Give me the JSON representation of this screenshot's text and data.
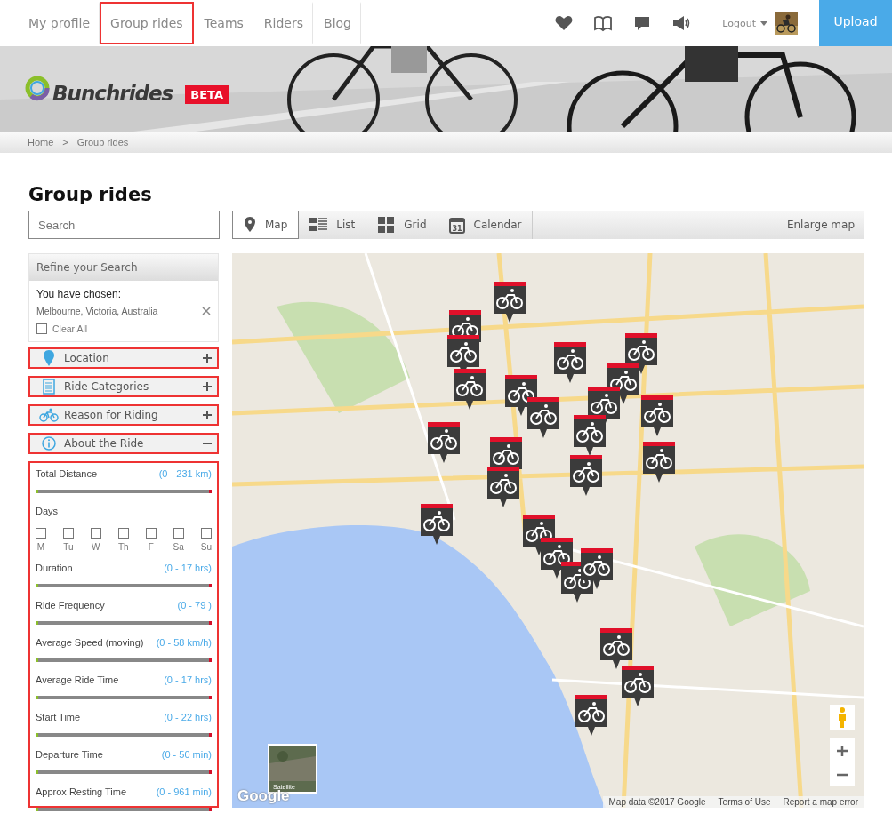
{
  "nav": {
    "links": [
      {
        "label": "My profile",
        "highlighted": false
      },
      {
        "label": "Group rides",
        "highlighted": true
      },
      {
        "label": "Teams",
        "highlighted": false
      },
      {
        "label": "Riders",
        "highlighted": false
      },
      {
        "label": "Blog",
        "highlighted": false
      }
    ],
    "logout": "Logout",
    "upload": "Upload"
  },
  "header": {
    "brand": "Bunchrides",
    "badge": "BETA"
  },
  "breadcrumb": {
    "items": [
      "Home",
      "Group rides"
    ],
    "separator": ">"
  },
  "title": "Group rides",
  "search": {
    "placeholder": "Search"
  },
  "view_tabs": [
    {
      "label": "Map",
      "selected": true
    },
    {
      "label": "List",
      "selected": false
    },
    {
      "label": "Grid",
      "selected": false
    },
    {
      "label": "Calendar",
      "icon_text": "31",
      "selected": false
    }
  ],
  "enlarge": "Enlarge map",
  "refine": {
    "title": "Refine your Search",
    "chosen_label": "You have chosen:",
    "chosen": "Melbourne, Victoria, Australia",
    "clear_all": {
      "label": "Clear All",
      "checked": false
    }
  },
  "sections": [
    {
      "label": "Location",
      "expanded": false,
      "highlighted": true
    },
    {
      "label": "Ride Categories",
      "expanded": false,
      "highlighted": true
    },
    {
      "label": "Reason for Riding",
      "expanded": false,
      "highlighted": true
    },
    {
      "label": "About the Ride",
      "expanded": true,
      "highlighted": true
    }
  ],
  "filters": {
    "highlighted": true,
    "items": [
      {
        "kind": "slider",
        "label": "Total Distance",
        "range": "(0 - 231 km)",
        "level": 1
      },
      {
        "kind": "days",
        "label": "Days",
        "days": [
          {
            "label": "M",
            "checked": false
          },
          {
            "label": "Tu",
            "checked": false
          },
          {
            "label": "W",
            "checked": false
          },
          {
            "label": "Th",
            "checked": false
          },
          {
            "label": "F",
            "checked": false
          },
          {
            "label": "Sa",
            "checked": false
          },
          {
            "label": "Su",
            "checked": false
          }
        ]
      },
      {
        "kind": "slider",
        "label": "Duration",
        "range": "(0 - 17 hrs)",
        "level": 1
      },
      {
        "kind": "slider",
        "label": "Ride Frequency",
        "range": "(0 - 79 )",
        "level": 1
      },
      {
        "kind": "slider",
        "label": "Average Speed (moving)",
        "range": "(0 - 58 km/h)",
        "level": 1
      },
      {
        "kind": "slider",
        "label": "Average Ride Time",
        "range": "(0 - 17 hrs)",
        "level": 1
      },
      {
        "kind": "slider",
        "label": "Start Time",
        "range": "(0 - 22 hrs)",
        "level": 1
      },
      {
        "kind": "slider",
        "label": "Departure Time",
        "range": "(0 - 50 min)",
        "level": 1
      },
      {
        "kind": "slider",
        "label": "Approx Resting Time",
        "range": "(0 - 961 min)",
        "level": 1
      }
    ]
  },
  "map": {
    "satellite": "Satellite",
    "logo": "Google",
    "attribution": "Map data ©2017 Google",
    "terms": "Terms of Use",
    "report": "Report a map error"
  }
}
